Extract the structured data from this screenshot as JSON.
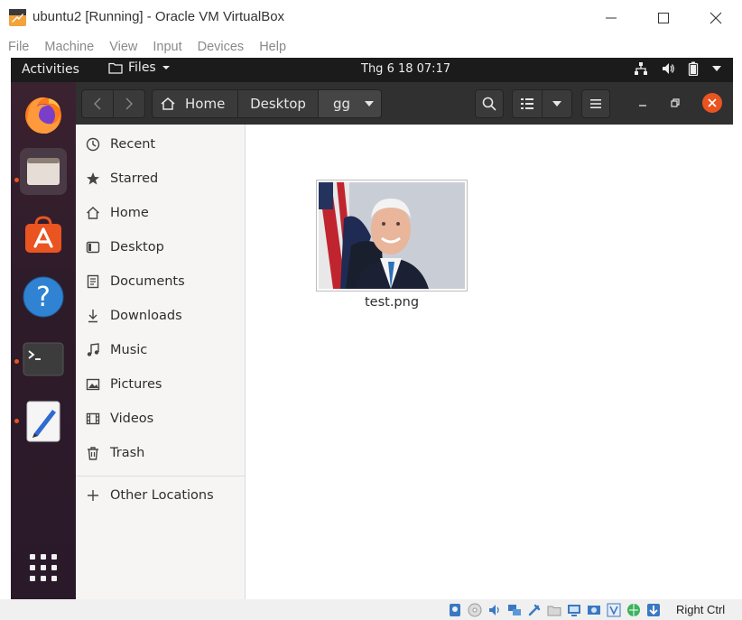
{
  "host_window": {
    "title": "ubuntu2 [Running] - Oracle VM VirtualBox",
    "menu": [
      "File",
      "Machine",
      "View",
      "Input",
      "Devices",
      "Help"
    ],
    "host_key_label": "Right Ctrl"
  },
  "gnome_topbar": {
    "activities": "Activities",
    "app_menu": "Files",
    "clock": "Thg 6 18  07:17"
  },
  "dock": {
    "apps": [
      {
        "name": "Firefox",
        "icon": "firefox-icon",
        "running": false
      },
      {
        "name": "Files",
        "icon": "files-folder-icon",
        "running": true,
        "active": true
      },
      {
        "name": "Ubuntu Software",
        "icon": "software-store-icon",
        "running": false
      },
      {
        "name": "Help",
        "icon": "help-icon",
        "running": false
      },
      {
        "name": "Terminal",
        "icon": "terminal-icon",
        "running": true
      },
      {
        "name": "Text Editor",
        "icon": "text-editor-icon",
        "running": true
      }
    ],
    "show_apps_icon": "app-grid-icon"
  },
  "nautilus": {
    "breadcrumbs": [
      "Home",
      "Desktop",
      "gg"
    ],
    "sidebar": [
      {
        "label": "Recent",
        "icon": "recent-clock-icon"
      },
      {
        "label": "Starred",
        "icon": "star-icon"
      },
      {
        "label": "Home",
        "icon": "home-icon"
      },
      {
        "label": "Desktop",
        "icon": "desktop-icon"
      },
      {
        "label": "Documents",
        "icon": "document-icon"
      },
      {
        "label": "Downloads",
        "icon": "download-icon"
      },
      {
        "label": "Music",
        "icon": "music-icon"
      },
      {
        "label": "Pictures",
        "icon": "picture-icon"
      },
      {
        "label": "Videos",
        "icon": "video-icon"
      },
      {
        "label": "Trash",
        "icon": "trash-icon"
      }
    ],
    "other_locations": "Other Locations",
    "files": [
      {
        "name": "test.png",
        "type": "image"
      }
    ]
  },
  "colors": {
    "ubuntu_orange": "#e95420",
    "header_bg": "#303030",
    "sidebar_bg": "#f6f5f4",
    "close_button": "#e95420"
  }
}
